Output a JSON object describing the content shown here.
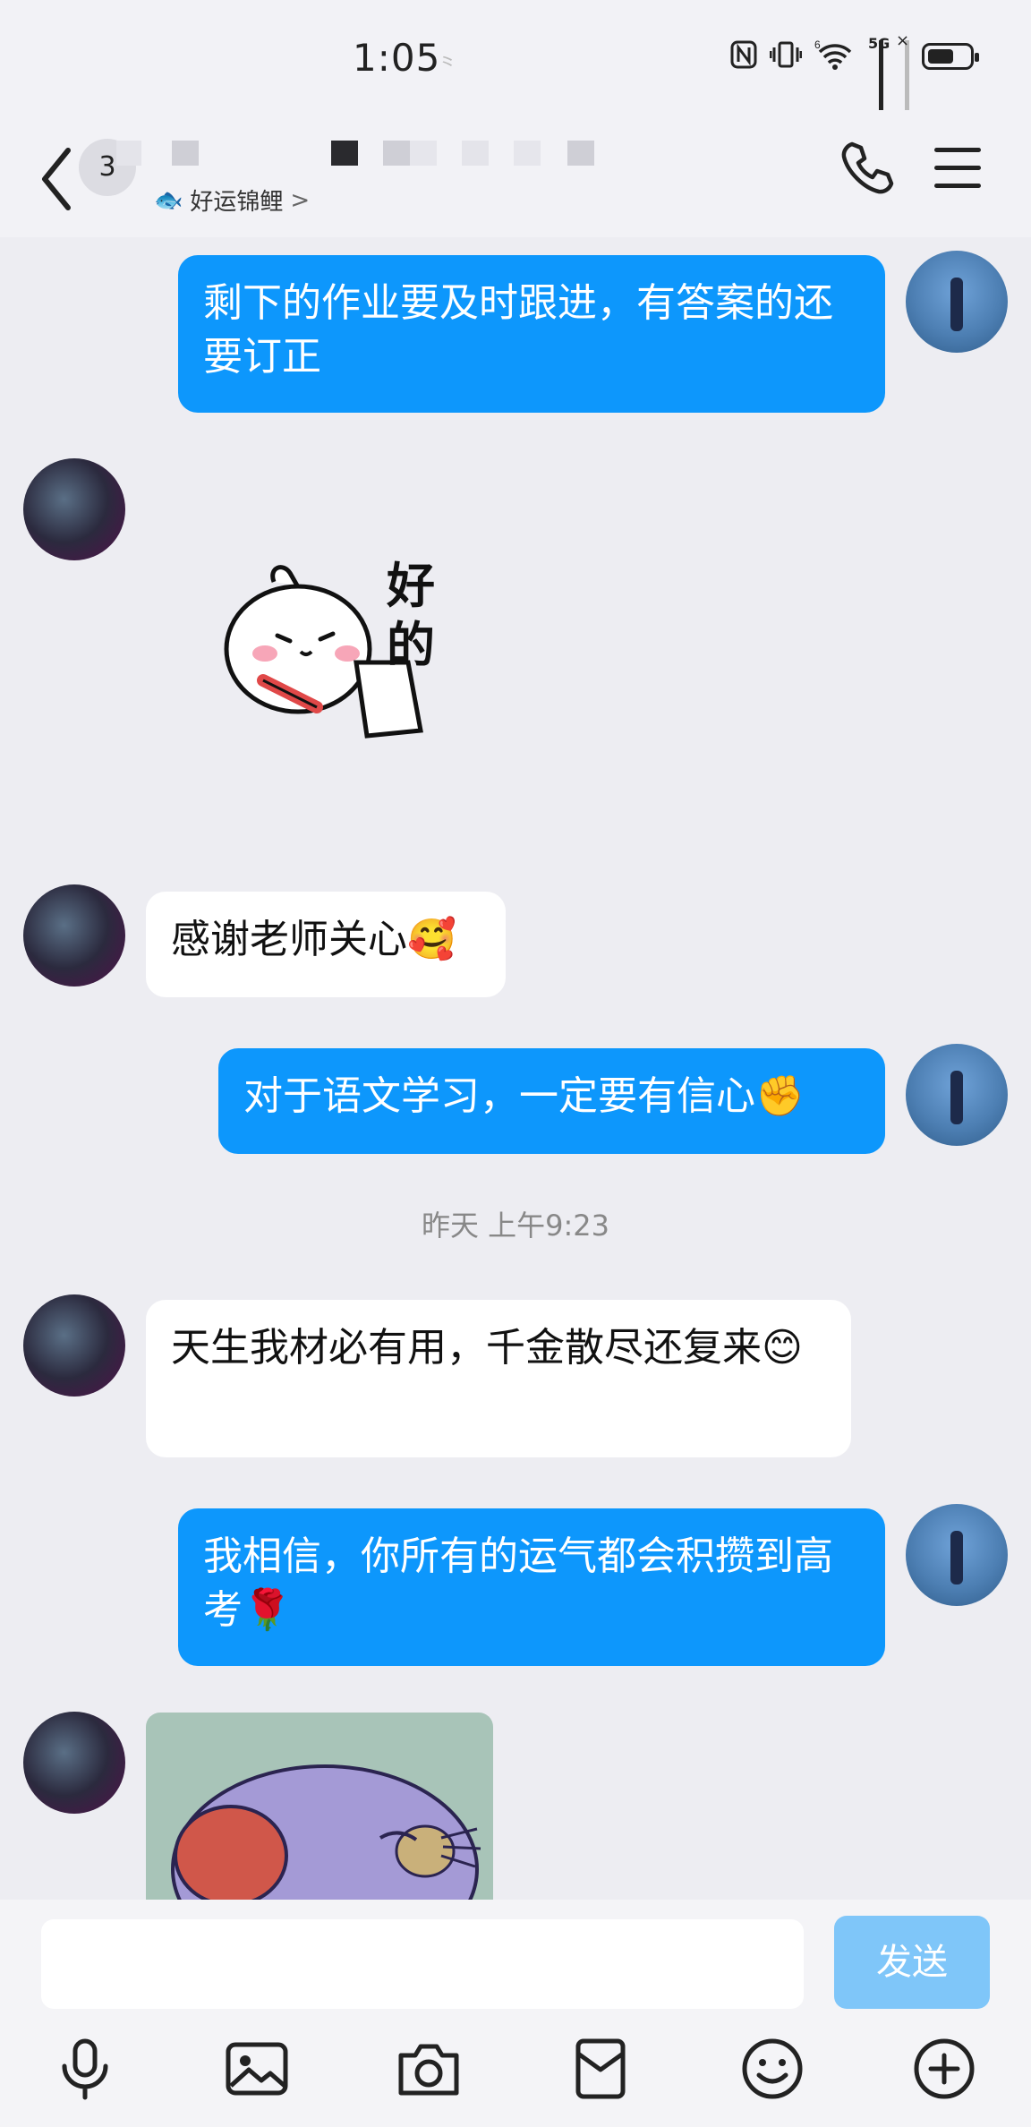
{
  "status_bar": {
    "time": "1:05",
    "time_extra": "⺀",
    "network": "5G",
    "signal_slot": "6"
  },
  "header": {
    "unread_count": "3",
    "contact_status": "好运锦鲤",
    "status_chevron": ">"
  },
  "messages": [
    {
      "side": "self",
      "text": "剩下的作业要及时跟进，有答案的还要订正"
    },
    {
      "side": "other",
      "type": "sticker",
      "sticker_text": "好的"
    },
    {
      "side": "other",
      "text": "感谢老师关心",
      "emoji": "🥰"
    },
    {
      "side": "self",
      "text": "对于语文学习，一定要有信心",
      "emoji": "✊"
    },
    {
      "side": "other",
      "text": "天生我材必有用，千金散尽还复来",
      "emoji": "😊"
    },
    {
      "side": "self",
      "text": "我相信，你所有的运气都会积攒到高考",
      "emoji": "🌹"
    },
    {
      "side": "other",
      "type": "image"
    }
  ],
  "timestamp": "昨天 上午9:23",
  "input": {
    "placeholder": "",
    "send_label": "发送"
  },
  "toolbar": [
    "microphone-icon",
    "image-icon",
    "camera-icon",
    "red-packet-icon",
    "emoji-icon",
    "plus-icon"
  ],
  "colors": {
    "self_bubble": "#0d97fc",
    "other_bubble": "#ffffff",
    "send_button": "#7fc6f9",
    "background": "#ededf2"
  }
}
